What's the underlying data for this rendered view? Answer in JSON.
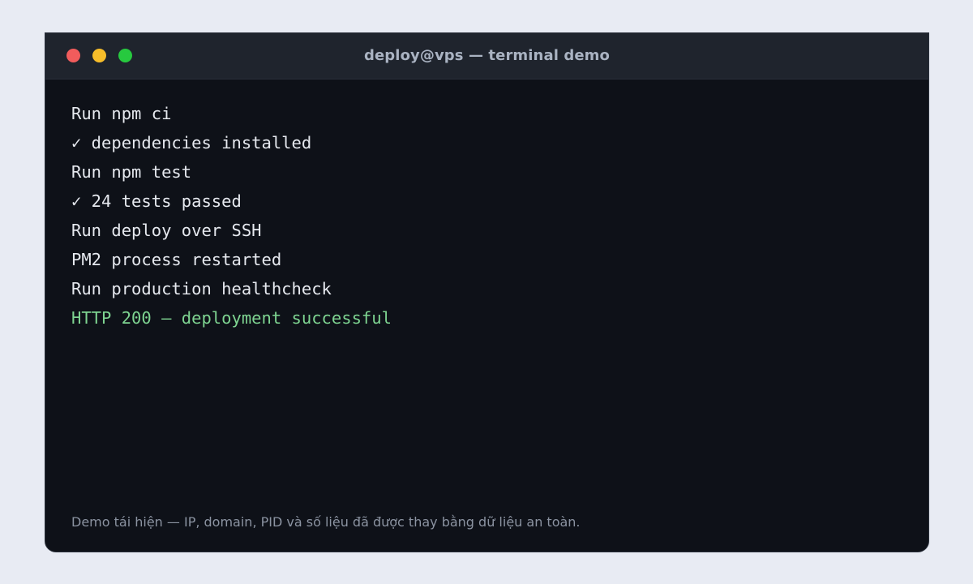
{
  "window": {
    "title": "deploy@vps — terminal demo",
    "buttons": {
      "close_color": "#f15c5c",
      "minimize_color": "#f7bd2a",
      "maximize_color": "#27c93f"
    }
  },
  "terminal": {
    "lines": [
      {
        "text": "Run npm ci",
        "status": "normal"
      },
      {
        "text": "✓ dependencies installed",
        "status": "normal"
      },
      {
        "text": "Run npm test",
        "status": "normal"
      },
      {
        "text": "✓ 24 tests passed",
        "status": "normal"
      },
      {
        "text": "Run deploy over SSH",
        "status": "normal"
      },
      {
        "text": "PM2 process restarted",
        "status": "normal"
      },
      {
        "text": "Run production healthcheck",
        "status": "normal"
      },
      {
        "text": "HTTP 200 — deployment successful",
        "status": "success"
      }
    ],
    "success_color": "#7ed491"
  },
  "footnote": "Demo tái hiện — IP, domain, PID và số liệu đã được thay bằng dữ liệu an toàn."
}
